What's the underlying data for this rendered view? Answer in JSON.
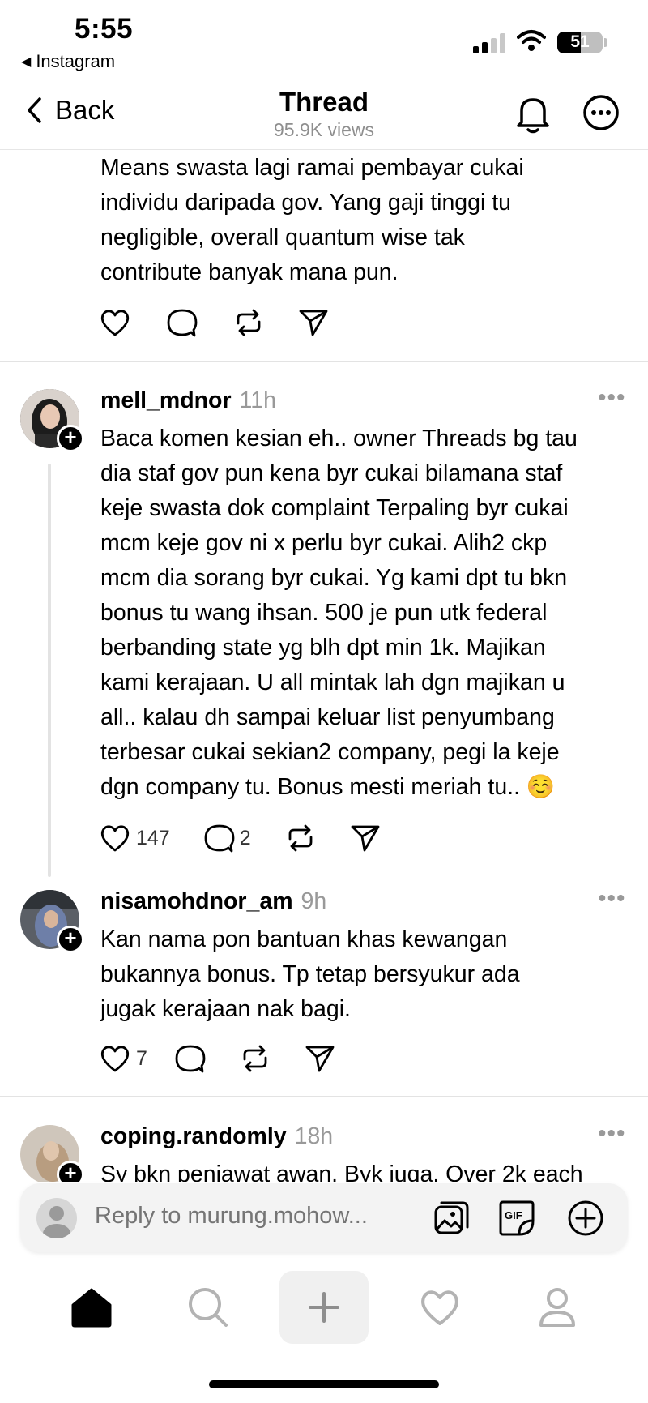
{
  "status_bar": {
    "time": "5:55",
    "back_app": "Instagram",
    "battery": "51",
    "battery_level": 0.51
  },
  "header": {
    "back_label": "Back",
    "title": "Thread",
    "views": "95.9K views"
  },
  "top_post": {
    "lines": [
      "Means swasta lagi ramai pembayar cukai",
      "individu daripada gov. Yang gaji tinggi tu",
      "negligible, overall quantum wise tak",
      "contribute banyak mana pun."
    ]
  },
  "replies": [
    {
      "username": "mell_mdnor",
      "time": "11h",
      "lines": [
        "Baca komen kesian eh.. owner Threads bg tau",
        "dia staf gov pun kena byr cukai bilamana staf",
        "keje swasta dok complaint Terpaling byr cukai",
        "mcm keje gov ni x perlu byr cukai. Alih2 ckp",
        "mcm dia sorang byr cukai. Yg kami dpt tu bkn",
        "bonus tu wang ihsan. 500 je pun utk federal",
        "berbanding state yg blh dpt min 1k. Majikan",
        "kami kerajaan. U all mintak lah dgn majikan u",
        "all.. kalau dh sampai keluar list penyumbang",
        "terbesar cukai sekian2 company, pegi la keje",
        "dgn company tu. Bonus mesti meriah tu.. ☺️"
      ],
      "likes": "147",
      "comments": "2"
    },
    {
      "username": "nisamohdnor_am",
      "time": "9h",
      "lines": [
        "Kan nama pon bantuan khas kewangan",
        "bukannya bonus. Tp tetap bersyukur ada",
        "jugak kerajaan nak bagi."
      ],
      "likes": "7"
    },
    {
      "username": "coping.randomly",
      "time": "18h",
      "lines": [
        "Sy bkn penjawat awan. Byk juga. Over 2k each"
      ]
    }
  ],
  "reply_bar": {
    "placeholder": "Reply to murung.mohow..."
  },
  "icons": {
    "like": "heart-icon",
    "comment": "comment-icon",
    "repost": "repost-icon",
    "share": "send-icon",
    "nav": [
      "home-icon",
      "search-icon",
      "plus-icon",
      "heart-icon",
      "profile-icon"
    ]
  }
}
